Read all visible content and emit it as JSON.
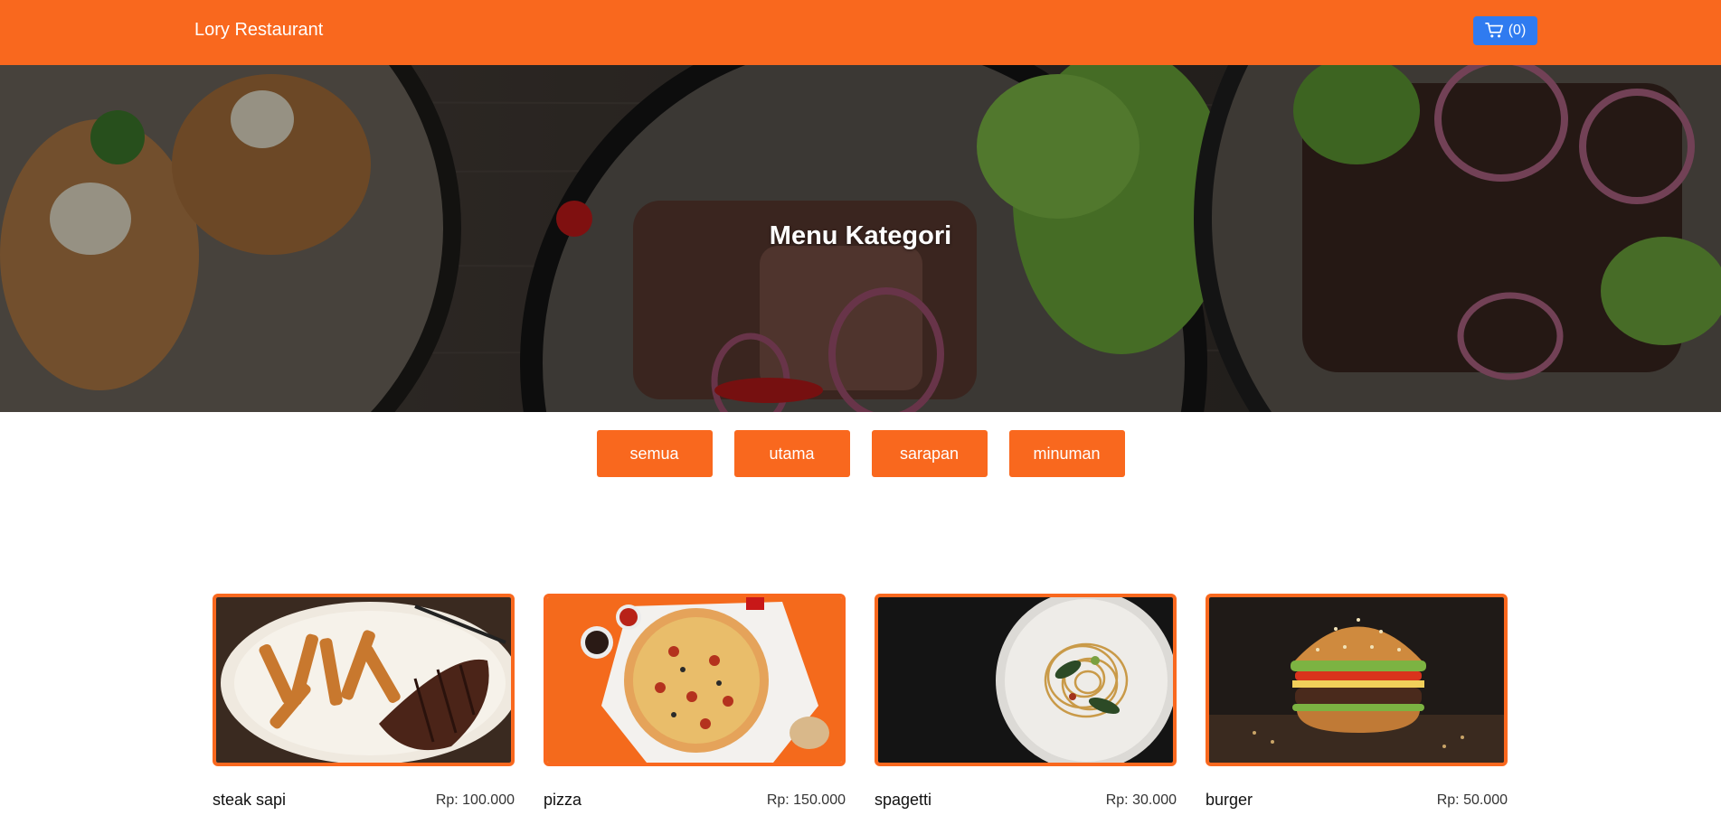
{
  "navbar": {
    "brand": "Lory Restaurant",
    "cart_count": "(0)",
    "cart_icon": "cart-icon",
    "color": "#f9681e",
    "cart_color": "#2f7bf0"
  },
  "hero": {
    "title": "Menu Kategori"
  },
  "categories": [
    "semua",
    "utama",
    "sarapan",
    "minuman"
  ],
  "menu": [
    {
      "name": "steak sapi",
      "price": "Rp: 100.000"
    },
    {
      "name": "pizza",
      "price": "Rp: 150.000"
    },
    {
      "name": "spagetti",
      "price": "Rp: 30.000"
    },
    {
      "name": "burger",
      "price": "Rp: 50.000"
    }
  ]
}
